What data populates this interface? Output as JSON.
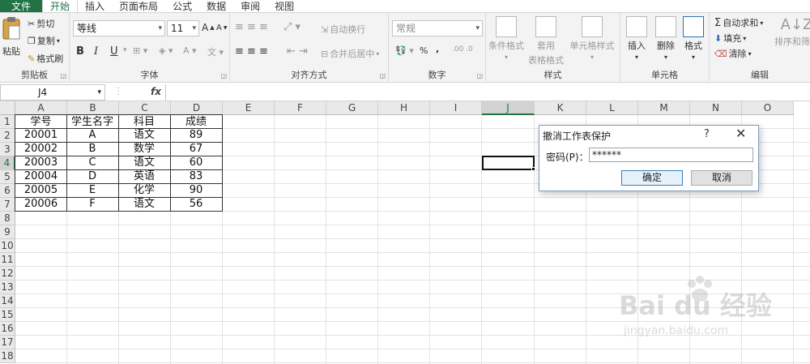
{
  "menu": {
    "tabs": [
      "文件",
      "开始",
      "插入",
      "页面布局",
      "公式",
      "数据",
      "审阅",
      "视图"
    ],
    "active": "开始"
  },
  "ribbon": {
    "clipboard": {
      "paste": "粘贴",
      "cut": "剪切",
      "copy": "复制",
      "format_painter": "格式刷",
      "label": "剪贴板"
    },
    "font": {
      "name": "等线",
      "size": "11",
      "label": "字体",
      "bold": "B",
      "italic": "I",
      "underline": "U",
      "grow": "A",
      "shrink": "A"
    },
    "align": {
      "wrap": "自动换行",
      "merge": "合并后居中",
      "label": "对齐方式"
    },
    "number": {
      "format": "常规",
      "percent": "%",
      "comma": ",",
      "label": "数字"
    },
    "styles": {
      "conditional": "条件格式",
      "table_format_1": "套用",
      "table_format_2": "表格格式",
      "cell_styles": "单元格样式",
      "label": "样式"
    },
    "cells": {
      "insert": "插入",
      "delete": "删除",
      "format": "格式",
      "label": "单元格"
    },
    "editing": {
      "autosum": "自动求和",
      "fill": "填充",
      "clear": "清除",
      "sort": "排序和筛选",
      "label": "编辑"
    }
  },
  "formula_bar": {
    "name_box": "J4",
    "fx": "fx",
    "content": ""
  },
  "columns": [
    "A",
    "B",
    "C",
    "D",
    "E",
    "F",
    "G",
    "H",
    "I",
    "J",
    "K",
    "L",
    "M",
    "N",
    "O"
  ],
  "selected_column": "J",
  "rows": [
    "1",
    "2",
    "3",
    "4",
    "5",
    "6",
    "7",
    "8",
    "9",
    "10",
    "11",
    "12",
    "13",
    "14",
    "15",
    "16",
    "17",
    "18"
  ],
  "selected_row": "4",
  "table": {
    "headers": [
      "学号",
      "学生名字",
      "科目",
      "成绩"
    ],
    "rows": [
      [
        "20001",
        "A",
        "语文",
        "89"
      ],
      [
        "20002",
        "B",
        "数学",
        "67"
      ],
      [
        "20003",
        "C",
        "语文",
        "60"
      ],
      [
        "20004",
        "D",
        "英语",
        "83"
      ],
      [
        "20005",
        "E",
        "化学",
        "90"
      ],
      [
        "20006",
        "F",
        "语文",
        "56"
      ]
    ]
  },
  "dialog": {
    "title": "撤消工作表保护",
    "help": "?",
    "close": "✕",
    "password_label": "密码(P)：",
    "password_value": "******",
    "ok": "确定",
    "cancel": "取消"
  },
  "watermark": {
    "text": "Bai du 经验",
    "url": "jingyan.baidu.com"
  }
}
